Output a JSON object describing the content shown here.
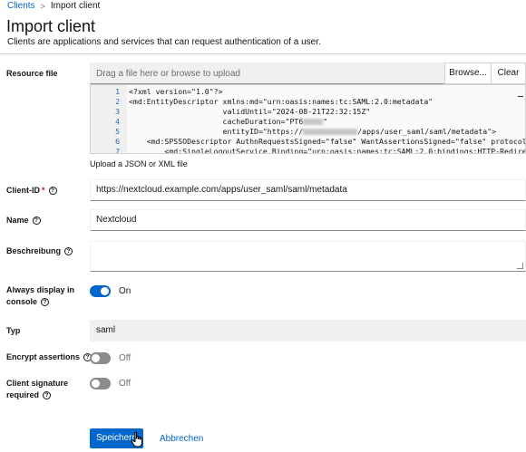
{
  "breadcrumb": {
    "link": "Clients",
    "separator": ">",
    "current": "Import client"
  },
  "header": {
    "title": "Import client",
    "subtitle": "Clients are applications and services that can request authentication of a user."
  },
  "resource_file": {
    "label": "Resource file",
    "placeholder": "Drag a file here or browse to upload",
    "browse_label": "Browse...",
    "clear_label": "Clear",
    "helper": "Upload a JSON or XML file",
    "code_lines": [
      {
        "n": "1",
        "text": "<?xml version=\"1.0\"?>"
      },
      {
        "n": "2",
        "text": "<md:EntityDescriptor xmlns:md=\"urn:oasis:names:tc:SAML:2.0:metadata\""
      },
      {
        "n": "3",
        "text": "                     validUntil=\"2024-08-21T22:32:15Z\""
      },
      {
        "n": "4",
        "text": "                     cacheDuration=\"PT6"
      },
      {
        "n": "5",
        "text": "                     entityID=\"https://"
      },
      {
        "n": "6",
        "text": "    <md:SPSSODescriptor AuthnRequestsSigned=\"false\" WantAssertionsSigned=\"false\" protocolSup"
      },
      {
        "n": "7",
        "text": "        <md:SingleLogoutService Binding=\"urn:oasis:names:tc:SAML:2.0:bindings:HTTP-Redirect\""
      }
    ],
    "line5_tail": "/apps/user_saml/saml/metadata\">",
    "line4_tail": "\""
  },
  "client_id": {
    "label": "Client-ID",
    "required_mark": "*",
    "value": "https://nextcloud.example.com/apps/user_saml/saml/metadata"
  },
  "name": {
    "label": "Name",
    "value": "Nextcloud"
  },
  "description": {
    "label": "Beschreibung",
    "value": ""
  },
  "always_display": {
    "label_line1": "Always display in",
    "label_line2": "console",
    "state": "On"
  },
  "type": {
    "label": "Typ",
    "value": "saml"
  },
  "encrypt_assertions": {
    "label": "Encrypt assertions",
    "state": "Off"
  },
  "client_signature": {
    "label_line1": "Client signature",
    "label_line2": "required",
    "state": "Off"
  },
  "actions": {
    "save_label": "Speichern",
    "cancel_label": "Abbrechen"
  },
  "help_glyph": "?",
  "colors": {
    "primary": "#0066cc",
    "toggle_off": "#8a8d90",
    "required": "#c9190b"
  }
}
